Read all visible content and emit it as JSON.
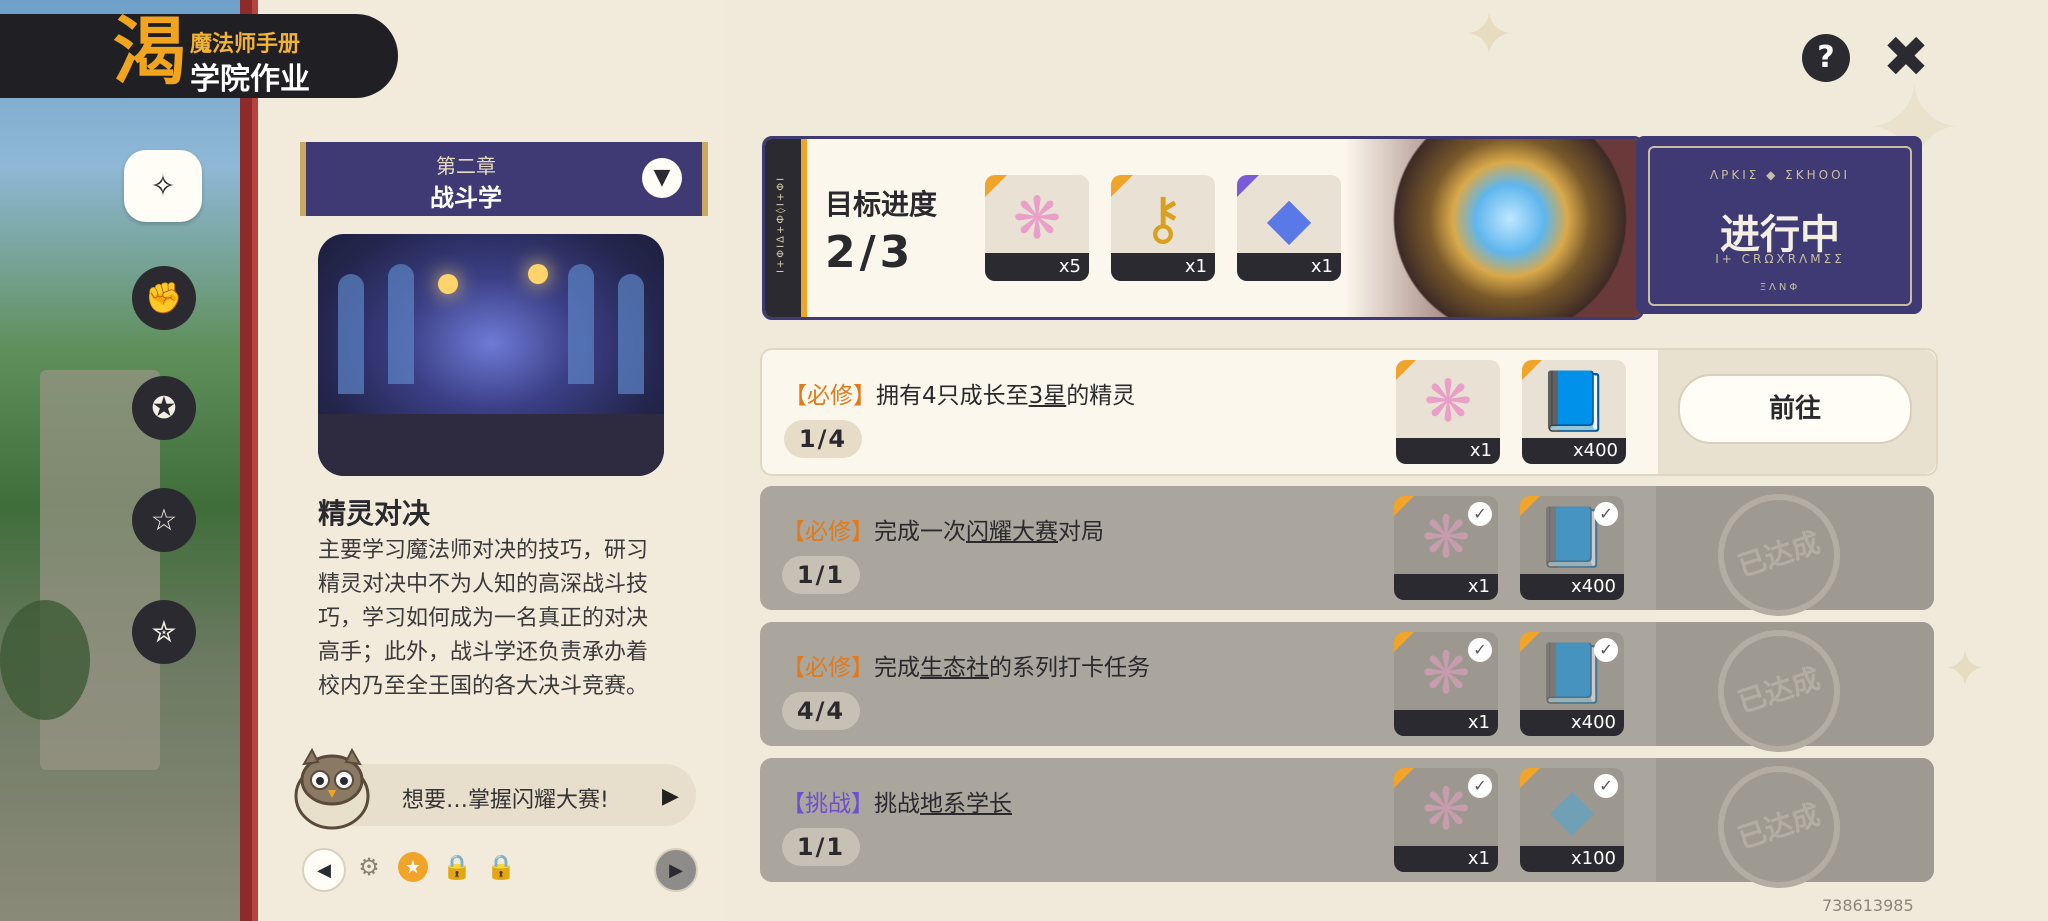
{
  "header": {
    "subtitle": "魔法师手册",
    "title": "学院作业",
    "logo_glyph": "渴"
  },
  "sidebar": {
    "items": [
      {
        "name": "compass-icon",
        "glyph": "✧",
        "active": true
      },
      {
        "name": "fist-card-icon",
        "glyph": "✊",
        "active": false
      },
      {
        "name": "star-moon-icon",
        "glyph": "✪",
        "active": false
      },
      {
        "name": "star-wand-icon",
        "glyph": "☆",
        "active": false
      },
      {
        "name": "star-ticket-icon",
        "glyph": "✮",
        "active": false
      }
    ]
  },
  "chapter": {
    "number": "第二章",
    "name": "战斗学",
    "dropdown_glyph": "▼",
    "skill_title": "精灵对决",
    "description": "主要学习魔法师对决的技巧，研习精灵对决中不为人知的高深战斗技巧，学习如何成为一名真正的对决高手；此外，战斗学还负责承办着校内乃至全王国的各大决斗竞赛。"
  },
  "hint": {
    "text": "想要…掌握闪耀大赛!",
    "play_glyph": "▶"
  },
  "pager": {
    "prev_glyph": "◀",
    "next_glyph": "▶",
    "progress_icons": [
      {
        "name": "gear-check-icon",
        "glyph": "⚙"
      },
      {
        "name": "current-star-icon",
        "glyph": "★"
      },
      {
        "name": "lock-icon",
        "glyph": "🔒"
      },
      {
        "name": "lock-icon",
        "glyph": "🔒"
      }
    ]
  },
  "topbar": {
    "help_glyph": "?",
    "close_glyph": "✖"
  },
  "goal": {
    "label": "目标进度",
    "value": "2/3",
    "strip_text": "I+ΦIΔ+Ф◊I+ΦI",
    "rewards": [
      {
        "name": "prism-crystal-icon",
        "glyph": "❋",
        "qty": "x5",
        "color": "#e8a0c8",
        "corner": "orange"
      },
      {
        "name": "golden-key-icon",
        "glyph": "⚷",
        "qty": "x1",
        "color": "#d9a020",
        "corner": "orange"
      },
      {
        "name": "blue-gem-icon",
        "glyph": "◆",
        "qty": "x1",
        "color": "#5a78e6",
        "corner": "purple"
      }
    ],
    "status_stamp": "进行中",
    "stamp_runes_top": "ΛΡΚΙΣ ◆ ΣΚΗΟΟΙ",
    "stamp_runes_bottom": "I+ CRΩXRΛΜΣΣ",
    "stamp_runes_foot": "ΞΛΝΦ"
  },
  "tasks": [
    {
      "tag": "必修",
      "tag_type": "required",
      "pre": "拥有4只成长至",
      "link": "3星",
      "post": "的精灵",
      "progress": "1/4",
      "status": "active",
      "action": "前往",
      "rewards": [
        {
          "glyph": "❋",
          "qty": "x1",
          "color": "#e8a0c8"
        },
        {
          "glyph": "📘",
          "qty": "x400",
          "color": "#3aa7a0"
        }
      ]
    },
    {
      "tag": "必修",
      "tag_type": "required",
      "pre": "完成一次",
      "link": "闪耀大赛",
      "post": "对局",
      "progress": "1/1",
      "status": "done",
      "stamp": "已达成",
      "rewards": [
        {
          "glyph": "❋",
          "qty": "x1",
          "color": "#e8a0c8"
        },
        {
          "glyph": "📘",
          "qty": "x400",
          "color": "#3aa7a0"
        }
      ]
    },
    {
      "tag": "必修",
      "tag_type": "required",
      "pre": "完成",
      "link": "生态社",
      "post": "的系列打卡任务",
      "progress": "4/4",
      "status": "done",
      "stamp": "已达成",
      "rewards": [
        {
          "glyph": "❋",
          "qty": "x1",
          "color": "#e8a0c8"
        },
        {
          "glyph": "📘",
          "qty": "x400",
          "color": "#3aa7a0"
        }
      ]
    },
    {
      "tag": "挑战",
      "tag_type": "challenge",
      "pre": "挑战",
      "link": "地系学长",
      "post": "",
      "progress": "1/1",
      "status": "done",
      "stamp": "已达成",
      "rewards": [
        {
          "glyph": "❋",
          "qty": "x1",
          "color": "#e8a0c8"
        },
        {
          "glyph": "◆",
          "qty": "x100",
          "color": "#4aa8d8"
        }
      ]
    }
  ],
  "uid": "738613985",
  "colors": {
    "accent_orange": "#f0a52a",
    "navy": "#3f3a73",
    "required_tag": "#e07a1a",
    "challenge_tag": "#6d4fd0"
  }
}
